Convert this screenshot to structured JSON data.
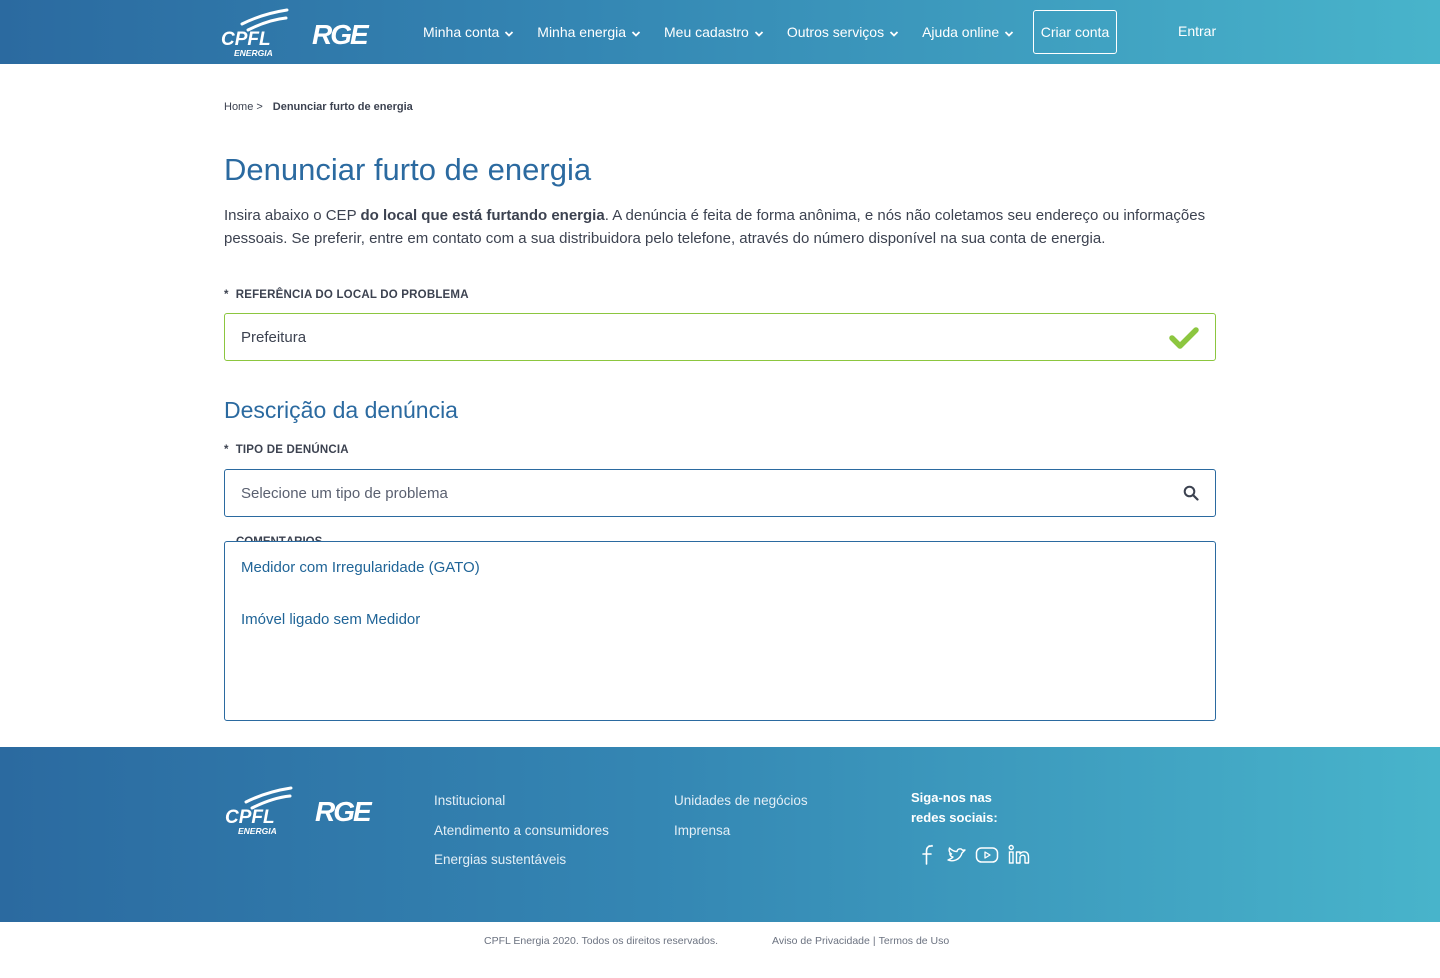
{
  "header": {
    "brand_primary": "CPFL",
    "brand_primary_sub": "ENERGIA",
    "brand_secondary": "RGE",
    "nav": [
      {
        "label": "Minha conta"
      },
      {
        "label": "Minha energia"
      },
      {
        "label": "Meu cadastro"
      },
      {
        "label": "Outros serviços"
      },
      {
        "label": "Ajuda online"
      }
    ],
    "create_account": "Criar conta",
    "login": "Entrar"
  },
  "breadcrumb": {
    "home": "Home",
    "separator": ">",
    "current": "Denunciar furto de energia"
  },
  "page": {
    "title": "Denunciar furto de energia",
    "intro_part1": "Insira abaixo o CEP ",
    "intro_bold": "do local que está furtando energia",
    "intro_part2": ". A denúncia é feita de forma anônima, e nós não coletamos seu endereço ou informações pessoais. Se preferir, entre em contato com a sua distribuidora pelo telefone, através do número disponível na sua conta de energia."
  },
  "form": {
    "required_mark": "*",
    "reference": {
      "label": "REFERÊNCIA DO LOCAL DO PROBLEMA",
      "value": "Prefeitura",
      "valid": true
    },
    "section_title": "Descrição da denúncia",
    "type": {
      "label": "TIPO DE DENÚNCIA",
      "placeholder": "Selecione um tipo de problema",
      "options": [
        "Medidor com Irregularidade (GATO)",
        "Imóvel ligado sem Medidor"
      ]
    },
    "obscured_label": "COMENTÁRIOS"
  },
  "footer": {
    "links_col1": [
      "Institucional",
      "Atendimento a consumidores",
      "Energias sustentáveis"
    ],
    "links_col2": [
      "Unidades de negócios",
      "Imprensa"
    ],
    "social_title_line1": "Siga-nos nas",
    "social_title_line2": "redes sociais:",
    "social": [
      "facebook-icon",
      "twitter-icon",
      "youtube-icon",
      "linkedin-icon"
    ],
    "copyright": "CPFL Energia 2020. Todos os direitos reservados.",
    "privacy": "Aviso de Privacidade",
    "legal_separator": "|",
    "terms": "Termos de Uso"
  },
  "colors": {
    "primary": "#2b6aa0",
    "accent_gradient_end": "#48b4cb",
    "valid_green": "#8cc63f",
    "text": "#3c4250"
  }
}
